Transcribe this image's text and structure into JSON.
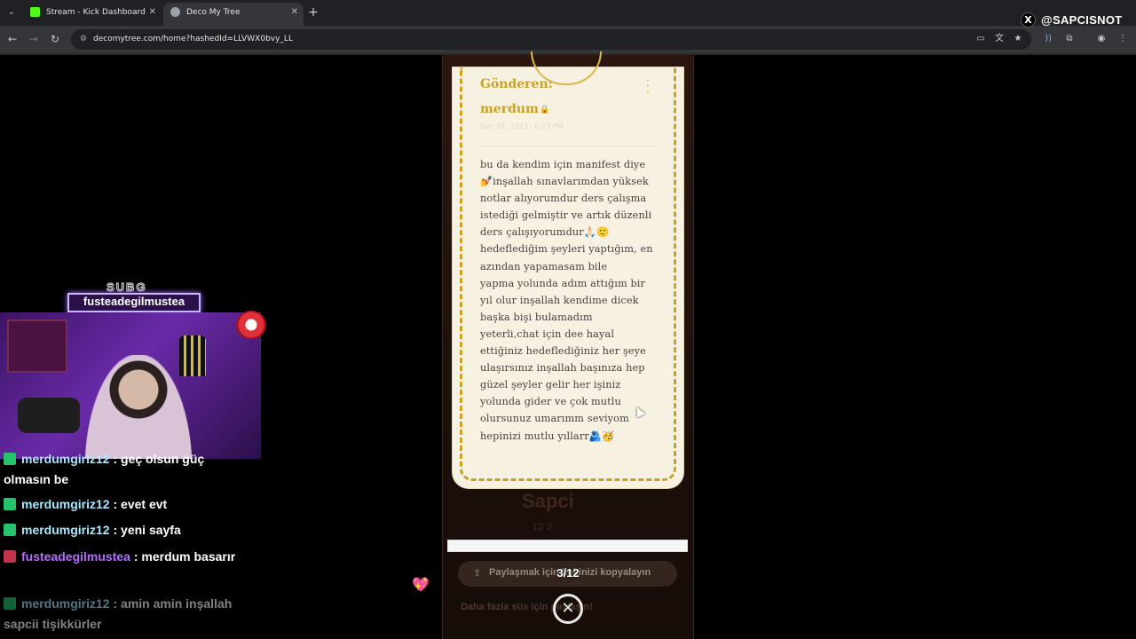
{
  "browser": {
    "tabs": [
      {
        "label": "Stream - Kick Dashboard",
        "favicon_color": "#53fc18",
        "active": false
      },
      {
        "label": "Deco My Tree",
        "favicon_color": "#9aa0a6",
        "active": true
      }
    ],
    "new_tab": "+",
    "url": "decomytree.com/home?hashedId=LLVWX0bvy_LL"
  },
  "stream_overlay": {
    "x_handle": "@SAPCISNOT",
    "sub_label": "SUBG",
    "sub_name": "fusteadegilmustea"
  },
  "card": {
    "sender_label": "Gönderen:",
    "sender_name": "merdum",
    "date": "Dec 27, 2023 · 8:23 PM",
    "message": "bu da kendim için manifest diye\n💅inşallah sınavlarımdan yüksek\nnotlar alıyorumdur ders çalışma\nistediği gelmiştir ve artık düzenli\nders çalışıyorumdur🙏🏻🙂\nhedeflediğim şeyleri yaptığım, en\nazından yapamasam bile\nyapma yolunda adım attığım bir\nyıl olur inşallah kendime dicek\nbaşka bişi bulamadım\nyeterli,chat için dee hayal\nettiğiniz hedeflediğiniz her şeye\nulaşırsınız inşallah başınıza hep\ngüzel şeyler gelir her işiniz\nyolunda gider ve çok mutlu\nolursunuz umarımm seviyom\nhepinizi mutlu yıllarr🫂🥳"
  },
  "page": {
    "owner_name": "Sapci",
    "stats": "12   2",
    "share_label": "Paylaşmak için linkinizi kopyalayın",
    "counter": "3/12",
    "more_text": "Daha fazla süs için paylaşın!"
  },
  "chat": [
    {
      "user": "merdumgiriz12",
      "text": ": geç olsun güç olmasın be",
      "badge": "green",
      "name_color": "#a8e8ff"
    },
    {
      "user": "merdumgiriz12",
      "text": ": evet evt",
      "badge": "green",
      "name_color": "#a8e8ff"
    },
    {
      "user": "merdumgiriz12",
      "text": ": yeni sayfa",
      "badge": "green",
      "name_color": "#a8e8ff"
    },
    {
      "user": "fusteadegilmustea",
      "text": ": merdum basarır",
      "badge": "red",
      "name_color": "#b46bff"
    },
    {
      "user": "merdumgiriz12",
      "text": ": amin amin inşallah sapcii tişikkürler",
      "badge": "green",
      "name_color": "#a8e8ff"
    }
  ]
}
